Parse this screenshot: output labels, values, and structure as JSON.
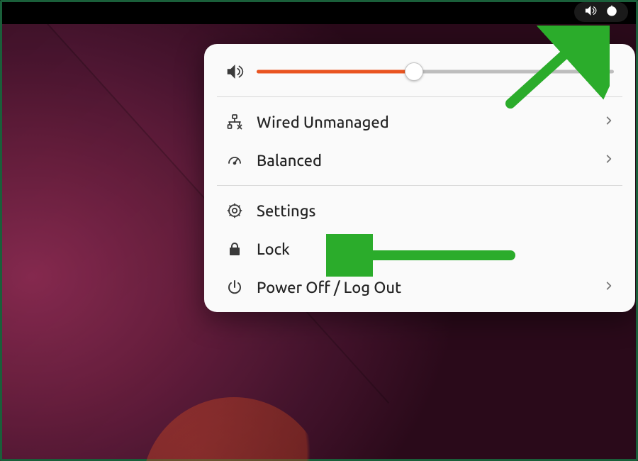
{
  "topbar": {
    "status": {
      "volume_icon": "volume-icon",
      "power_icon": "power-icon"
    }
  },
  "menu": {
    "volume": {
      "level": 0.44
    },
    "items": {
      "network": {
        "label": "Wired Unmanaged",
        "has_submenu": true
      },
      "power_mode": {
        "label": "Balanced",
        "has_submenu": true
      },
      "settings": {
        "label": "Settings",
        "has_submenu": false
      },
      "lock": {
        "label": "Lock",
        "has_submenu": false
      },
      "power_off": {
        "label": "Power Off / Log Out",
        "has_submenu": true
      }
    }
  },
  "annotations": {
    "arrow1_target": "system-status-area",
    "arrow2_target": "settings-menu-item",
    "arrow_color": "#2bac2b"
  }
}
